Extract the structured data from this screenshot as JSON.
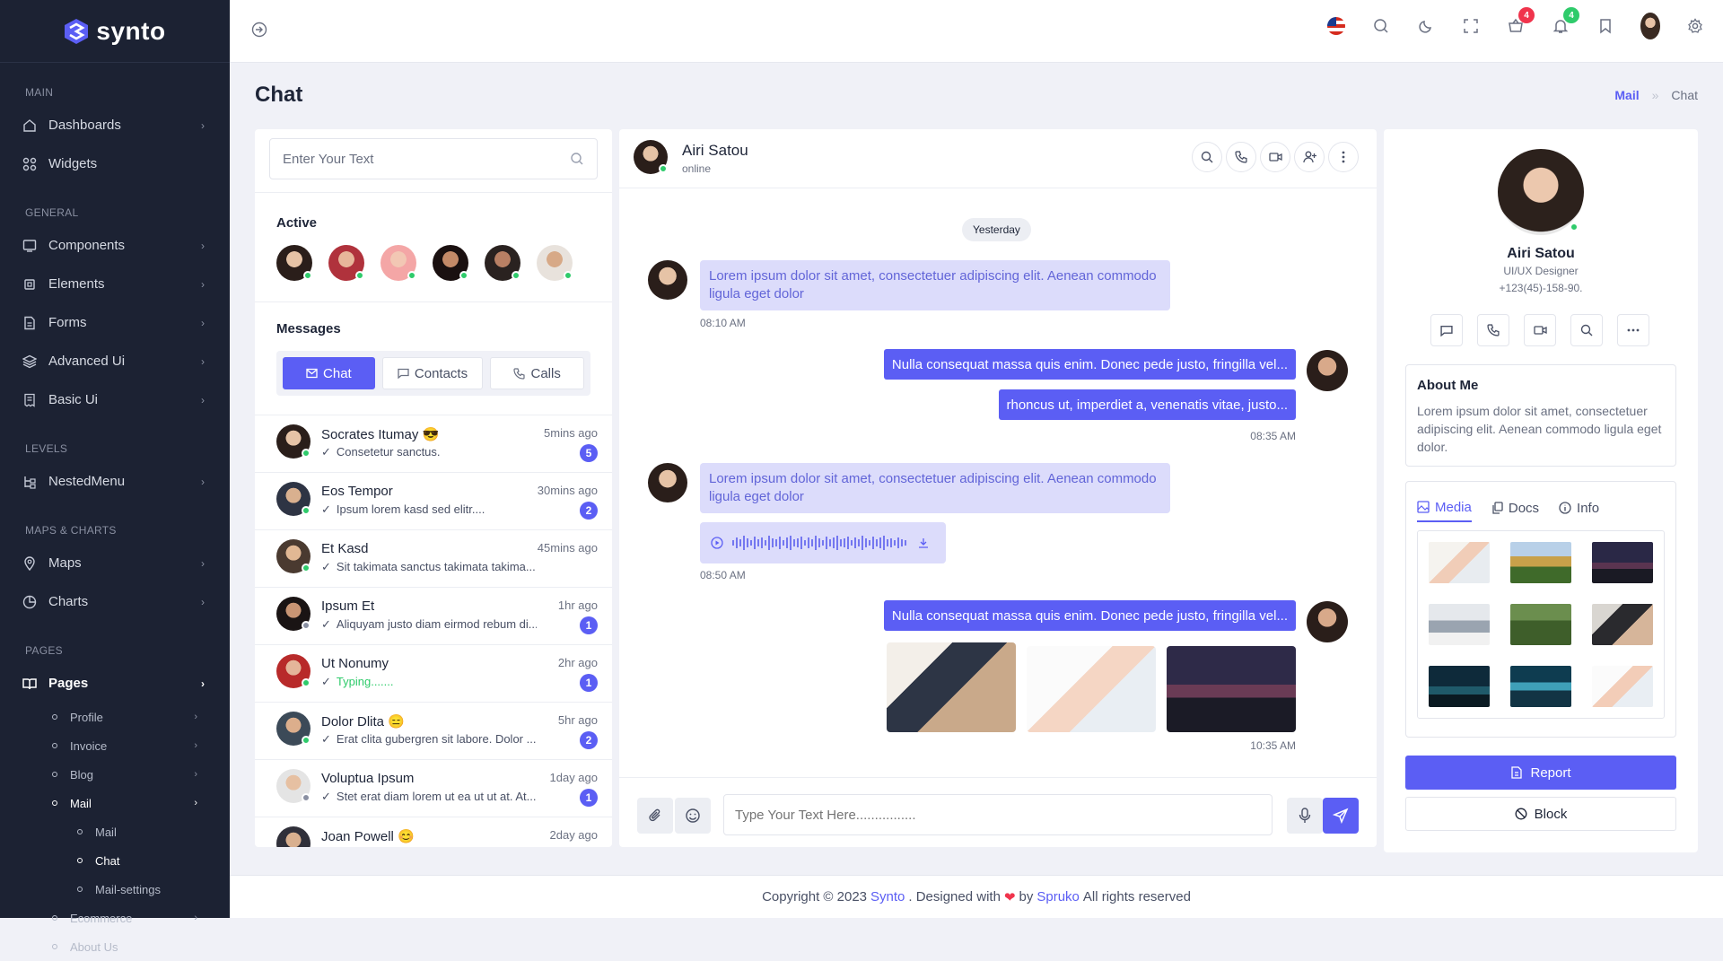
{
  "brand": {
    "name": "synto"
  },
  "sidebar": {
    "categories": [
      "MAIN",
      "GENERAL",
      "LEVELS",
      "MAPS & CHARTS",
      "PAGES"
    ],
    "items": {
      "dashboards": "Dashboards",
      "widgets": "Widgets",
      "components": "Components",
      "elements": "Elements",
      "forms": "Forms",
      "advanced": "Advanced Ui",
      "basic": "Basic Ui",
      "nested": "NestedMenu",
      "maps": "Maps",
      "charts": "Charts",
      "pages": "Pages"
    },
    "sub": {
      "profile": "Profile",
      "invoice": "Invoice",
      "blog": "Blog",
      "mail": "Mail",
      "mail2": "Mail",
      "chat": "Chat",
      "mailsettings": "Mail-settings",
      "ecommerce": "Ecommerce",
      "about": "About Us"
    }
  },
  "header": {
    "cart_count": "4",
    "notif_count": "4"
  },
  "page": {
    "title": "Chat",
    "breadcrumb": [
      "Mail",
      "Chat"
    ]
  },
  "left": {
    "search_placeholder": "Enter Your Text",
    "active_title": "Active",
    "messages_title": "Messages",
    "tabs": [
      "Chat",
      "Contacts",
      "Calls"
    ],
    "contacts": [
      {
        "name": "Socrates Itumay 😎",
        "msg": "Consetetur sanctus.",
        "time": "5mins ago",
        "count": "5"
      },
      {
        "name": "Eos Tempor",
        "msg": "Ipsum lorem kasd sed elitr....",
        "time": "30mins ago",
        "count": "2"
      },
      {
        "name": "Et Kasd",
        "msg": "Sit takimata sanctus takimata takima...",
        "time": "45mins ago",
        "count": ""
      },
      {
        "name": "Ipsum Et",
        "msg": "Aliquyam justo diam eirmod rebum di...",
        "time": "1hr ago",
        "count": "1"
      },
      {
        "name": "Ut Nonumy",
        "msg": "Typing.......",
        "time": "2hr ago",
        "count": "1"
      },
      {
        "name": "Dolor Dlita 😑",
        "msg": "Erat clita gubergren sit labore. Dolor ...",
        "time": "5hr ago",
        "count": "2"
      },
      {
        "name": "Voluptua Ipsum",
        "msg": "Stet erat diam lorem ut ea ut ut at. At...",
        "time": "1day ago",
        "count": "1"
      },
      {
        "name": "Joan Powell 😊",
        "msg": "",
        "time": "2day ago",
        "count": ""
      }
    ]
  },
  "chat": {
    "name": "Airi Satou",
    "status": "online",
    "day": "Yesterday",
    "m1": "Lorem ipsum dolor sit amet, consectetuer adipiscing elit. Aenean commodo ligula eget dolor",
    "t1": "08:10 AM",
    "m2": "Nulla consequat massa quis enim. Donec pede justo, fringilla vel...",
    "m3": "rhoncus ut, imperdiet a, venenatis vitae, justo...",
    "t2": "08:35 AM",
    "m4": "Lorem ipsum dolor sit amet, consectetuer adipiscing elit. Aenean commodo ligula eget dolor",
    "t3": "08:50 AM",
    "m5": "Nulla consequat massa quis enim. Donec pede justo, fringilla vel...",
    "t4": "10:35 AM",
    "input_placeholder": "Type Your Text Here................"
  },
  "profile": {
    "name": "Airi Satou",
    "role": "UI/UX Designer",
    "phone": "+123(45)-158-90.",
    "about_title": "About Me",
    "about": "Lorem ipsum dolor sit amet, consectetuer adipiscing elit. Aenean commodo ligula eget dolor.",
    "tabs": [
      "Media",
      "Docs",
      "Info"
    ],
    "report": "Report",
    "block": "Block"
  },
  "footer": {
    "pre": "Copyright © 2023",
    "brand": "Synto",
    "mid": ". Designed with",
    "by": "by",
    "company": "Spruko",
    "post": "All rights reserved"
  },
  "colors": {
    "accent": "#5b5ef4",
    "sidebar": "#1c2233",
    "online": "#2fcb6b"
  }
}
